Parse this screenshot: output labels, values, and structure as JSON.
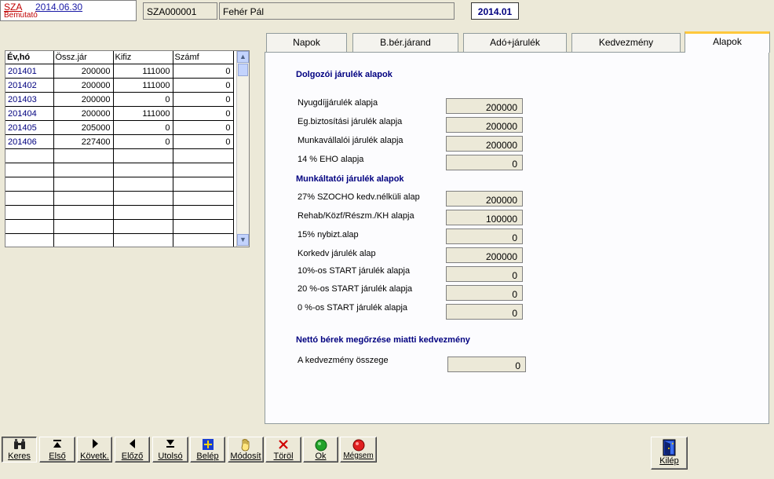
{
  "header": {
    "app_code": "SZA",
    "app_date": "2014.06.30",
    "app_mode": "Bemutató",
    "employee_id": "SZA000001",
    "employee_name": "Fehér Pál",
    "period": "2014.01"
  },
  "grid": {
    "columns": [
      "Év,hó",
      "Össz.jár",
      "Kifiz",
      "Számf"
    ],
    "rows": [
      [
        "201401",
        "200000",
        "111000",
        "0"
      ],
      [
        "201402",
        "200000",
        "111000",
        "0"
      ],
      [
        "201403",
        "200000",
        "0",
        "0"
      ],
      [
        "201404",
        "200000",
        "111000",
        "0"
      ],
      [
        "201405",
        "205000",
        "0",
        "0"
      ],
      [
        "201406",
        "227400",
        "0",
        "0"
      ]
    ]
  },
  "tabs": [
    "Napok",
    "B.bér.járand",
    "Adó+járulék",
    "Kedvezmény",
    "Alapok"
  ],
  "active_tab": "Alapok",
  "panel": {
    "section1_title": "Dolgozói járulék alapok",
    "section1_fields": [
      {
        "label": "Nyugdíjjárulék alapja",
        "value": "200000"
      },
      {
        "label": "Eg.biztosítási járulék alapja",
        "value": "200000"
      },
      {
        "label": "Munkavállalói járulék alapja",
        "value": "200000"
      },
      {
        "label": "14 % EHO alapja",
        "value": "0"
      }
    ],
    "section2_title": "Munkáltatói járulék alapok",
    "section2_fields": [
      {
        "label": "27% SZOCHO kedv.nélküli alap",
        "value": "200000"
      },
      {
        "label": "Rehab/Közf/Részm./KH alapja",
        "value": "100000"
      },
      {
        "label": "15% nybizt.alap",
        "value": "0"
      },
      {
        "label": "Korkedv járulék alap",
        "value": "200000"
      },
      {
        "label": "10%-os START járulék alapja",
        "value": "0"
      },
      {
        "label": "20 %-os START járulék alapja",
        "value": "0"
      },
      {
        "label": "0 %-os START járulék alapja",
        "value": "0"
      }
    ],
    "section3_title": "Nettó bérek megőrzése miatti kedvezmény",
    "section3_fields": [
      {
        "label": "A kedvezmény összege",
        "value": "0"
      }
    ]
  },
  "toolbar": {
    "buttons": [
      {
        "label": "Keres",
        "icon": "binoculars-icon"
      },
      {
        "label": "Első",
        "icon": "first-record-icon"
      },
      {
        "label": "Követk.",
        "icon": "next-record-icon"
      },
      {
        "label": "Előző",
        "icon": "previous-record-icon"
      },
      {
        "label": "Utolsó",
        "icon": "last-record-icon"
      },
      {
        "label": "Belép",
        "icon": "add-icon"
      },
      {
        "label": "Módosít",
        "icon": "hand-edit-icon"
      },
      {
        "label": "Töröl",
        "icon": "delete-x-icon"
      },
      {
        "label": "Ok",
        "icon": "ok-green-icon"
      },
      {
        "label": "Mégsem",
        "icon": "cancel-red-icon"
      }
    ],
    "exit_label": "Kilép",
    "exit_icon": "exit-door-icon"
  },
  "colors": {
    "background": "#ece9d8",
    "section_title": "#000080",
    "active_tab_accent": "#ffc83c",
    "app_code": "#c00000"
  }
}
